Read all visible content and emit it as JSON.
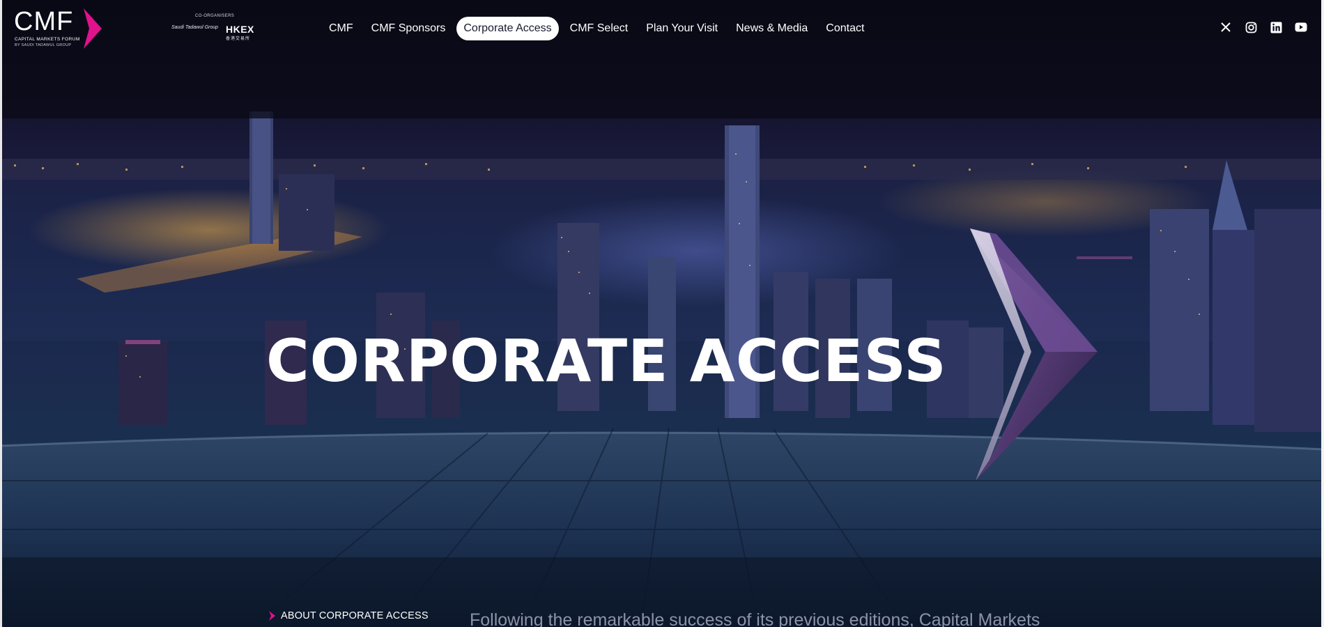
{
  "brand": {
    "logo_text": "CMF",
    "logo_subtitle": "CAPITAL MARKETS FORUM",
    "logo_tagline": "BY SAUDI TADAWUL GROUP",
    "accent_color": "#e0128c"
  },
  "coorganisers": {
    "label": "CO-ORGANISERS",
    "saudi": "Saudi Tadawul Group",
    "hkex": "HKEX",
    "hkex_sub": "香港交易所"
  },
  "nav": {
    "items": [
      {
        "label": "CMF",
        "active": false
      },
      {
        "label": "CMF Sponsors",
        "active": false
      },
      {
        "label": "Corporate Access",
        "active": true
      },
      {
        "label": "CMF Select",
        "active": false
      },
      {
        "label": "Plan Your Visit",
        "active": false
      },
      {
        "label": "News & Media",
        "active": false
      },
      {
        "label": "Contact",
        "active": false
      }
    ]
  },
  "social": [
    "x-icon",
    "instagram-icon",
    "linkedin-icon",
    "youtube-icon"
  ],
  "hero": {
    "title": "CORPORATE ACCESS"
  },
  "section": {
    "label": "ABOUT CORPORATE ACCESS",
    "intro": "Following the remarkable success of its previous editions, Capital Markets"
  }
}
